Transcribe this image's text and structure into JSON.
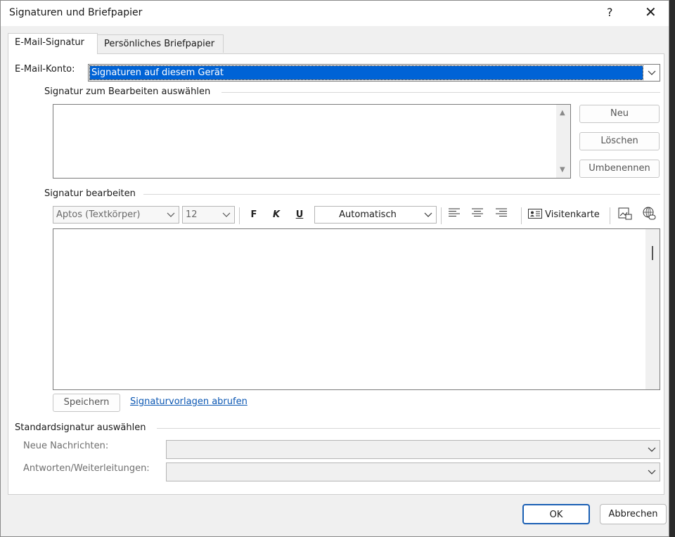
{
  "window": {
    "title": "Signaturen und Briefpapier",
    "help": "?",
    "close": "✕"
  },
  "tabs": [
    {
      "label": "E-Mail-Signatur"
    },
    {
      "label": "Persönliches Briefpapier"
    }
  ],
  "account": {
    "label": "E-Mail-Konto:",
    "value": "Signaturen auf diesem Gerät"
  },
  "select_section": {
    "title": "Signatur zum Bearbeiten auswählen",
    "new": "Neu",
    "delete": "Löschen",
    "rename": "Umbenennen"
  },
  "edit_section": {
    "title": "Signatur bearbeiten",
    "font": "Aptos (Textkörper)",
    "size": "12",
    "bold": "F",
    "italic": "K",
    "underline": "U",
    "color": "Automatisch",
    "business_card": "Visitenkarte"
  },
  "save": "Speichern",
  "templates_link": "Signaturvorlagen abrufen",
  "default_section": {
    "title": "Standardsignatur auswählen",
    "new_messages": "Neue Nachrichten:",
    "replies": "Antworten/Weiterleitungen:"
  },
  "footer": {
    "ok": "OK",
    "cancel": "Abbrechen"
  }
}
